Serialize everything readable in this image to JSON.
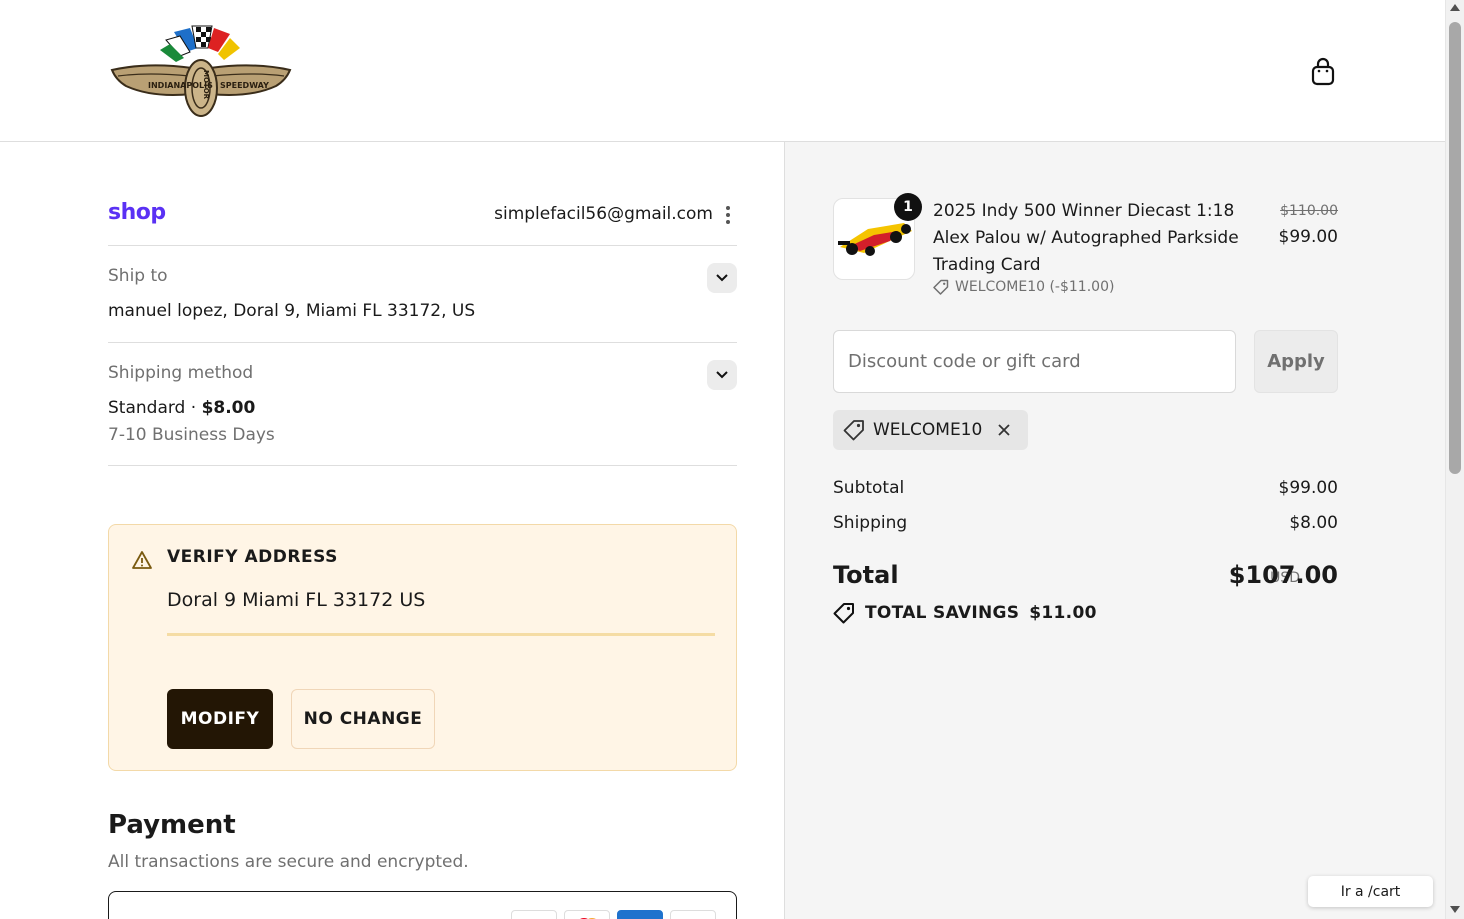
{
  "header": {
    "logo_text_left": "INDIANAPOLIS",
    "logo_text_center": "MOTOR",
    "logo_text_right": "SPEEDWAY",
    "cart_icon": "shopping-bag-icon"
  },
  "account": {
    "shop_label": "shop",
    "email": "simplefacil56@gmail.com"
  },
  "ship_to": {
    "label": "Ship to",
    "value": "manuel lopez, Doral 9, Miami FL 33172, US"
  },
  "shipping_method": {
    "label": "Shipping method",
    "name": "Standard",
    "separator": "·",
    "price": "$8.00",
    "eta": "7-10 Business Days"
  },
  "verify_address": {
    "title": "VERIFY ADDRESS",
    "address": "Doral 9 Miami FL 33172 US",
    "modify_label": "MODIFY",
    "no_change_label": "NO CHANGE"
  },
  "payment": {
    "title": "Payment",
    "subtitle": "All transactions are secure and encrypted."
  },
  "order": {
    "quantity": "1",
    "product_title": "2025 Indy 500 Winner Diecast 1:18 Alex Palou w/ Autographed Parkside Trading Card",
    "discount_line": "WELCOME10 (-$11.00)",
    "price_original": "$110.00",
    "price_current": "$99.00"
  },
  "discount": {
    "placeholder": "Discount code or gift card",
    "apply_label": "Apply",
    "applied_code": "WELCOME10"
  },
  "summary": {
    "subtotal_label": "Subtotal",
    "subtotal_value": "$99.00",
    "shipping_label": "Shipping",
    "shipping_value": "$8.00",
    "total_label": "Total",
    "currency": "USD",
    "total_value": "$107.00",
    "savings_label": "TOTAL SAVINGS",
    "savings_value": "$11.00"
  },
  "floating": {
    "goto_cart": "Ir a /cart"
  }
}
